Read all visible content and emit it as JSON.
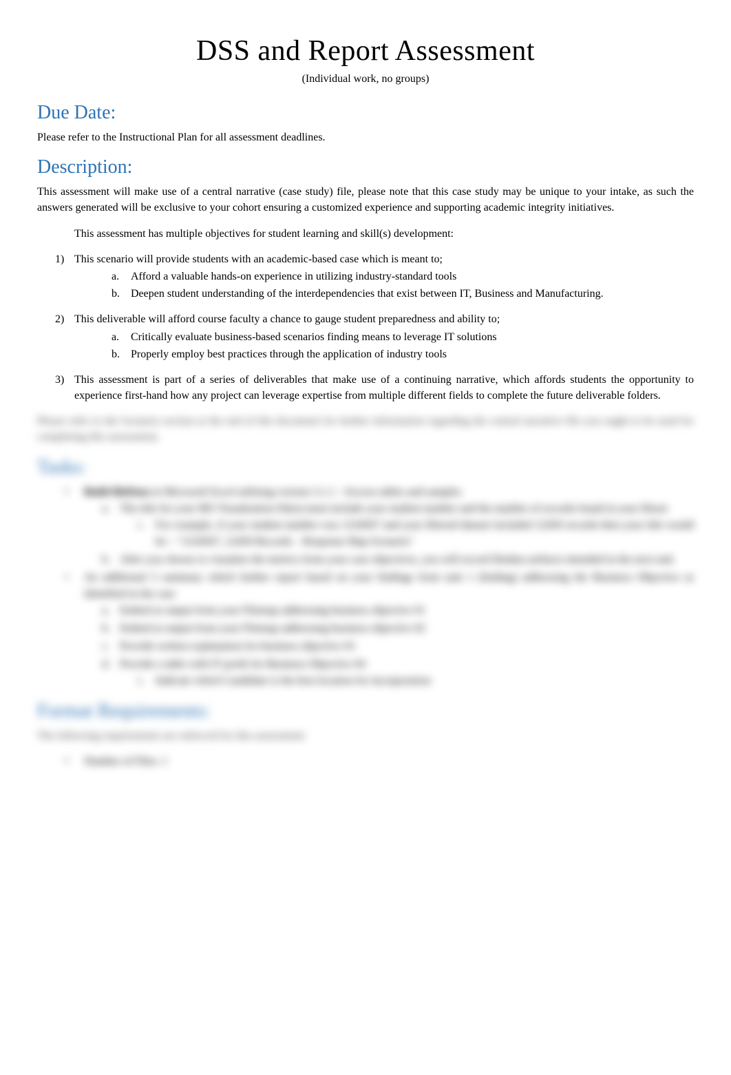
{
  "title": "DSS and Report Assessment",
  "subtitle": "(Individual work, no groups)",
  "sections": {
    "due_date": {
      "heading": "Due Date:",
      "text": "Please refer to the Instructional Plan for all assessment deadlines."
    },
    "description": {
      "heading": "Description:",
      "intro": "This assessment will make use of a central narrative (case study) file, please note that this case study may be unique to your intake, as such the answers generated will be exclusive to your cohort ensuring a customized experience and supporting academic integrity initiatives.",
      "objectives_intro": "This assessment has multiple objectives for student learning and skill(s) development:",
      "objectives": [
        {
          "marker": "1)",
          "text": "This scenario will provide students with an academic-based case which is meant to;",
          "sub": [
            {
              "marker": "a.",
              "text": "Afford a valuable hands-on experience in utilizing industry-standard tools"
            },
            {
              "marker": "b.",
              "text": "Deepen student understanding of the interdependencies that exist between IT, Business and Manufacturing."
            }
          ]
        },
        {
          "marker": "2)",
          "text": "This deliverable will afford course faculty a chance to gauge student preparedness and ability to;",
          "sub": [
            {
              "marker": "a.",
              "text": "Critically evaluate business-based scenarios finding means to leverage IT solutions"
            },
            {
              "marker": "b.",
              "text": "Properly employ best practices through the application of industry tools"
            }
          ]
        },
        {
          "marker": "3)",
          "text": "This assessment is part of a series of deliverables that make use of a continuing narrative, which affords students the opportunity to experience first-hand how any project can leverage expertise from multiple different fields to complete the future deliverable folders."
        }
      ]
    }
  },
  "blurred": {
    "scenario_note": "Please refer to the Scenario section at the end of this document for further information regarding the central narrative file you ought to be used for completing this assessment.",
    "tasks_heading": "Tasks:",
    "tasks": [
      {
        "text_bold": "Build fileData",
        "text_rest": " in Microsoft Excel utilizing version 3.1.1 – Excess tables and samples",
        "sub": [
          {
            "marker": "a.",
            "text": "The title for your MS Visualization file(s) must include your student number and the number of records found in your fileset",
            "roman": [
              {
                "marker": "i.",
                "text": "For example, if your student number was 1234567 and your filtered dataset included 12450 records then your title would be – \"1234567_12450 Records – Response Map Scenario\""
              }
            ]
          },
          {
            "marker": "b.",
            "text": "After you choose to visualize the metrics from your case objectives, you will record filedata artifacts intended in the next task"
          }
        ]
      },
      {
        "text": "An additional 5 summary which further report based on your findings from task 1 (finding) addressing the Business Objective as identified in the case",
        "sub": [
          {
            "marker": "a.",
            "text": "Embed at output from your Filemap addressing business objective #1"
          },
          {
            "marker": "b.",
            "text": "Embed at output from your Filemap addressing business objective #2"
          },
          {
            "marker": "c.",
            "text": "Provide written explanation for business objective #3"
          },
          {
            "marker": "d.",
            "text": "Provide a table with IT profit for Business Objective #4",
            "roman": [
              {
                "marker": "i.",
                "text": "Indicate which Candidate is the best location for incorporation"
              }
            ]
          }
        ]
      }
    ],
    "format_heading": "Format Requirements:",
    "format_intro": "The following requirements are enforced for this assessment:",
    "format_items": [
      {
        "text": "Number of Files: 1"
      }
    ]
  }
}
